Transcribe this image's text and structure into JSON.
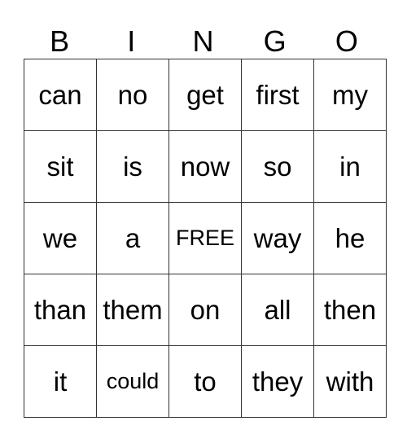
{
  "header": [
    "B",
    "I",
    "N",
    "G",
    "O"
  ],
  "rows": [
    [
      "can",
      "no",
      "get",
      "first",
      "my"
    ],
    [
      "sit",
      "is",
      "now",
      "so",
      "in"
    ],
    [
      "we",
      "a",
      "FREE",
      "way",
      "he"
    ],
    [
      "than",
      "them",
      "on",
      "all",
      "then"
    ],
    [
      "it",
      "could",
      "to",
      "they",
      "with"
    ]
  ]
}
